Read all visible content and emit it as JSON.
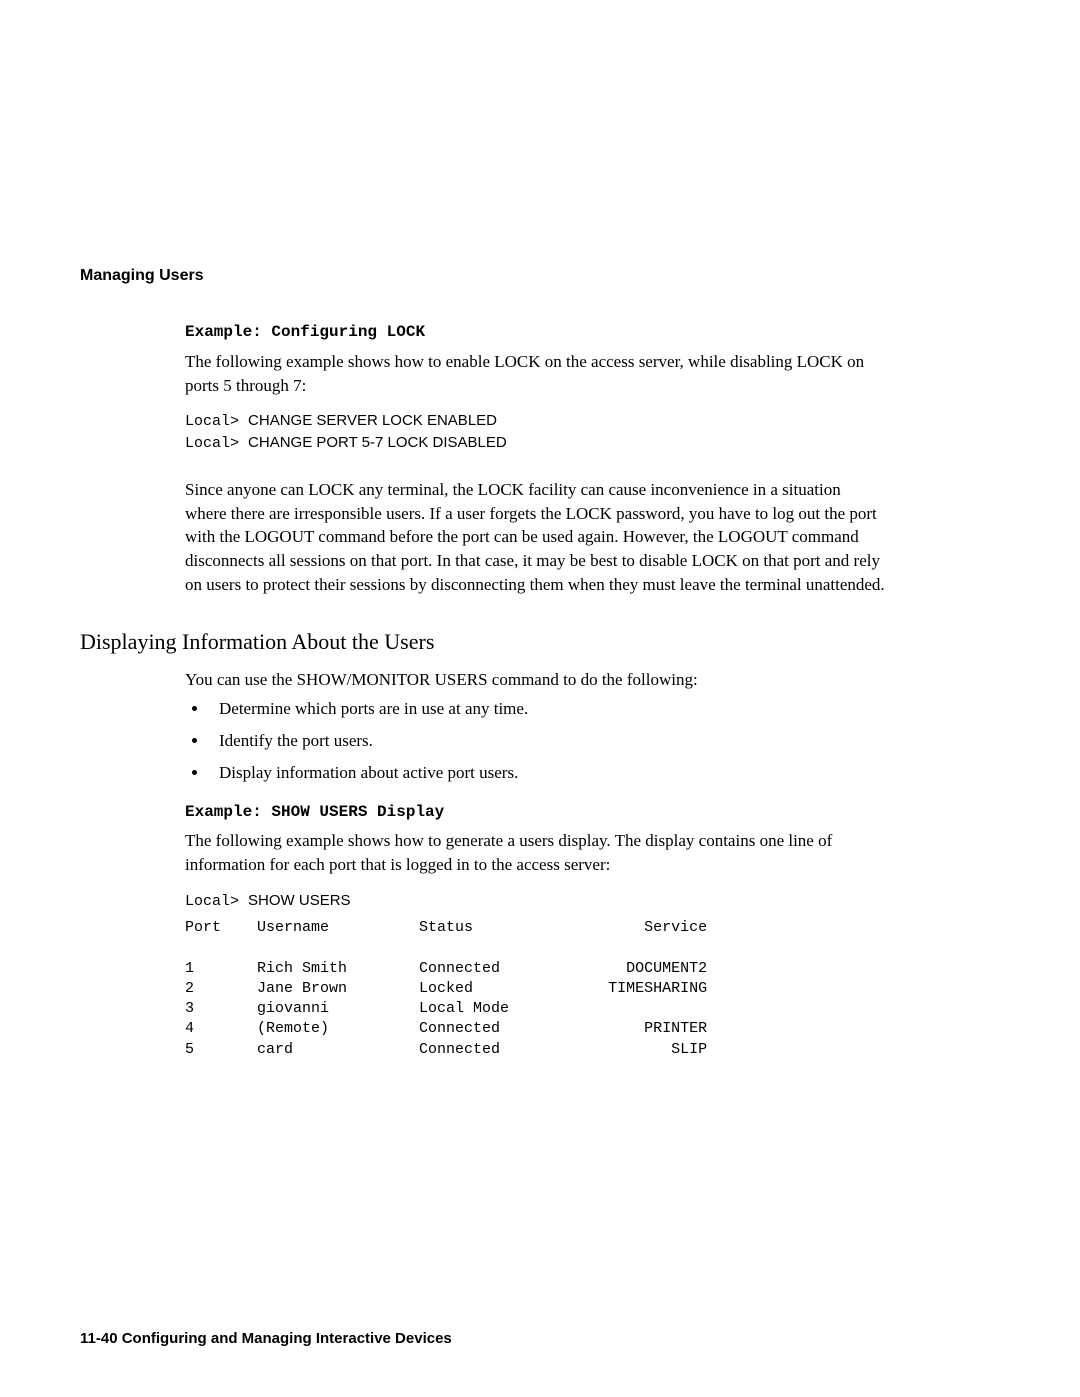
{
  "header": {
    "section": "Managing Users"
  },
  "example1": {
    "title": "Example: Configuring LOCK",
    "intro": "The following example shows how to enable LOCK on the access server, while disabling LOCK on ports 5 through 7:",
    "prompt": "Local>",
    "cmd1": "CHANGE SERVER LOCK ENABLED",
    "cmd2": "CHANGE PORT 5-7 LOCK DISABLED",
    "followup": "Since anyone can LOCK any terminal, the LOCK facility can cause inconvenience in a situation where there are irresponsible users. If a user forgets the LOCK password, you have to log out the port with the LOGOUT command before the port can be used again. However, the LOGOUT command disconnects all sessions on that port. In that case, it may be best to disable LOCK on that port and rely on users to protect their sessions by disconnecting them when they must leave the terminal unattended."
  },
  "subsection": {
    "title": "Displaying Information About the Users",
    "intro": "You can use the SHOW/MONITOR USERS command to do the following:",
    "bullets": [
      "Determine which ports are in use at any time.",
      "Identify the port users.",
      "Display information about active port users."
    ]
  },
  "example2": {
    "title": "Example: SHOW USERS Display",
    "intro": "The following example shows how to generate a users display. The display contains one line of information for each port that is logged in to the access server:",
    "prompt": "Local>",
    "cmd": "SHOW USERS",
    "table": {
      "headers": {
        "c1": "Port",
        "c2": "Username",
        "c3": "Status",
        "c4": "Service"
      },
      "rows": [
        {
          "c1": "1",
          "c2": "Rich Smith",
          "c3": "Connected",
          "c4": "DOCUMENT2"
        },
        {
          "c1": "2",
          "c2": "Jane Brown",
          "c3": "Locked",
          "c4": "TIMESHARING"
        },
        {
          "c1": "3",
          "c2": "giovanni",
          "c3": "Local Mode",
          "c4": ""
        },
        {
          "c1": "4",
          "c2": "(Remote)",
          "c3": "Connected",
          "c4": "PRINTER"
        },
        {
          "c1": "5",
          "c2": "card",
          "c3": "Connected",
          "c4": "SLIP"
        }
      ]
    }
  },
  "footer": {
    "text": "11-40  Configuring and Managing Interactive Devices"
  }
}
